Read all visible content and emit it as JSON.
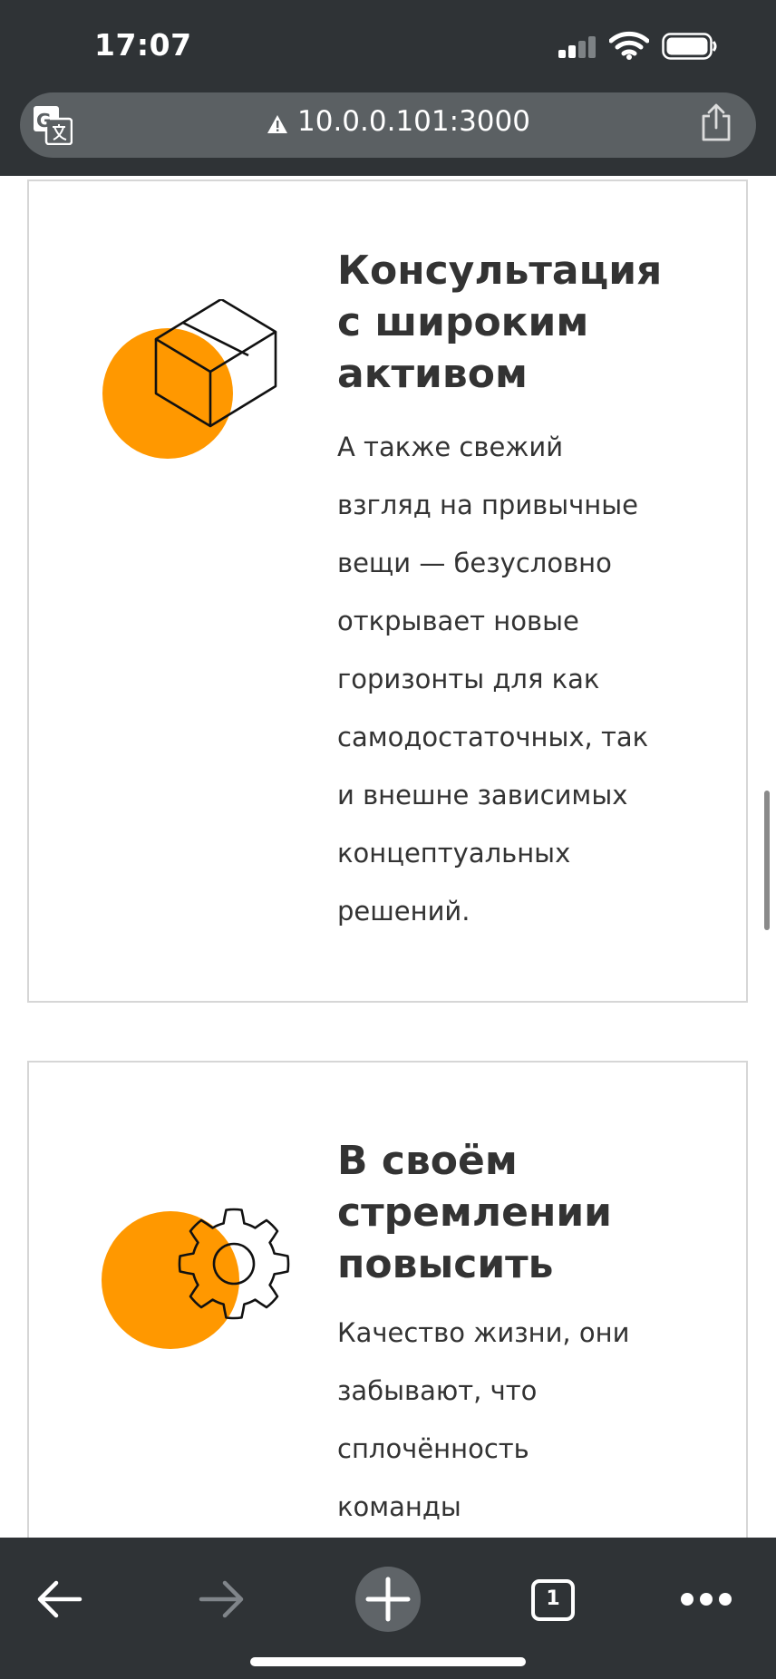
{
  "status_bar": {
    "time": "17:07"
  },
  "browser": {
    "url": "10.0.0.101:3000",
    "tab_count": "1"
  },
  "cards": [
    {
      "title_lines": [
        "Консультация",
        "с широким",
        "активом"
      ],
      "text_lines": [
        "А также свежий",
        "взгляд на привычные",
        "вещи — безусловно",
        "открывает новые",
        "горизонты для как",
        "самодостаточных, так",
        "и внешне зависимых",
        "концептуальных",
        "решений."
      ],
      "icon": "box-icon"
    },
    {
      "title_lines": [
        "В своём",
        "стремлении",
        "повысить"
      ],
      "text_lines": [
        "Качество жизни, они",
        "забывают, что",
        "сплочённость",
        "команды"
      ],
      "icon": "gear-icon"
    }
  ],
  "colors": {
    "accent": "#FF9800",
    "chrome": "#2F3336",
    "url_bar": "#5B6063"
  }
}
